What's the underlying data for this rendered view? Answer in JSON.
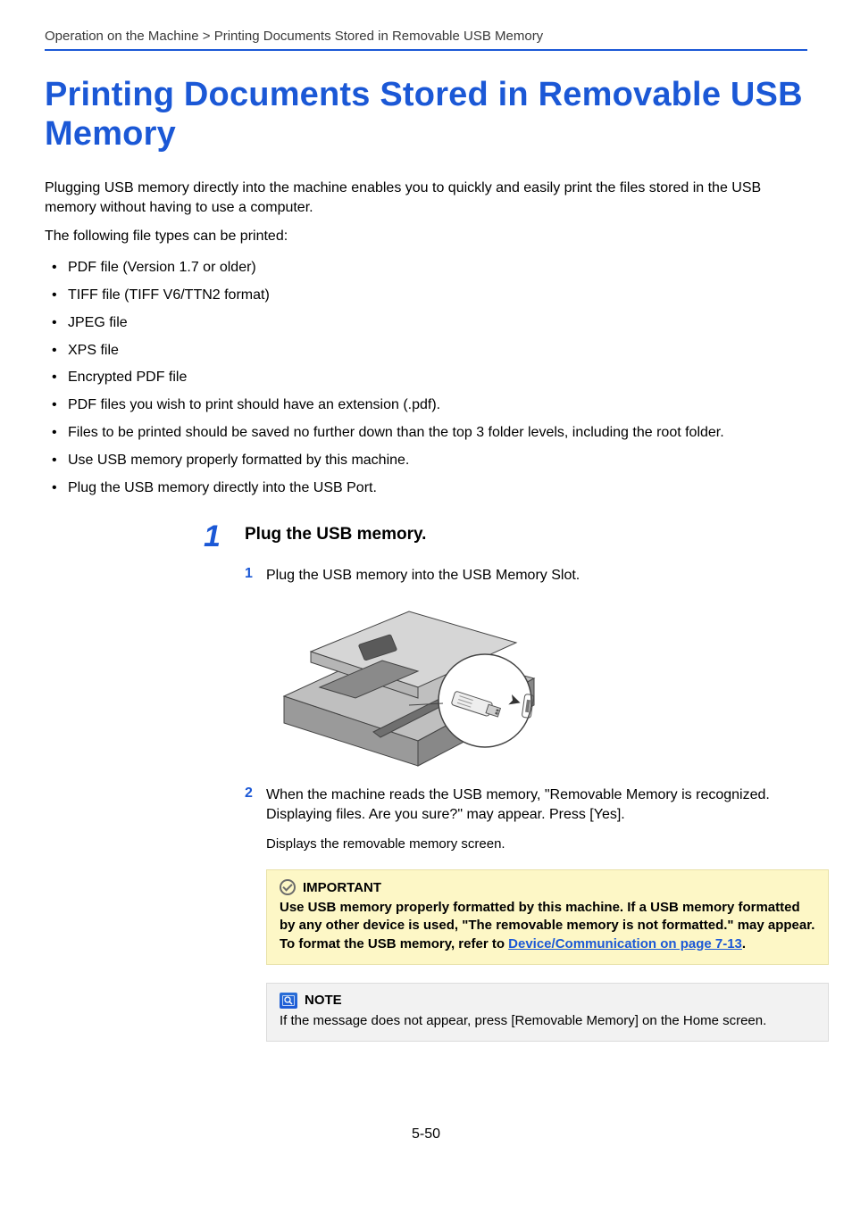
{
  "breadcrumb": "Operation on the Machine > Printing Documents Stored in Removable USB Memory",
  "title": "Printing Documents Stored in Removable USB Memory",
  "intro_p1": "Plugging USB memory directly into the machine enables you to quickly and easily print the files stored in the USB memory without having to use a computer.",
  "intro_p2": "The following file types can be printed:",
  "file_list": [
    "PDF file (Version 1.7 or older)",
    "TIFF file (TIFF V6/TTN2 format)",
    "JPEG file",
    "XPS file",
    "Encrypted PDF file",
    "PDF files you wish to print should have an extension (.pdf).",
    "Files to be printed should be saved no further down than the top 3 folder levels, including the root folder.",
    "Use USB memory properly formatted by this machine.",
    "Plug the USB memory directly into the USB Port."
  ],
  "step1": {
    "number": "1",
    "heading": "Plug the USB memory.",
    "sub1_num": "1",
    "sub1_text": "Plug the USB memory into the USB Memory Slot.",
    "sub2_num": "2",
    "sub2_text": "When the machine reads the USB memory, \"Removable Memory is recognized. Displaying files. Are you sure?\" may appear. Press [Yes].",
    "sub2_after": "Displays the removable memory screen."
  },
  "important": {
    "label": "IMPORTANT",
    "text_before_link": "Use USB memory properly formatted by this machine. If a USB memory formatted by any other device is used, \"The removable memory is not formatted.\" may appear. To format the USB memory, refer to ",
    "link_text": "Device/Communication on page 7-13",
    "text_after_link": "."
  },
  "note": {
    "label": "NOTE",
    "text": "If the message does not appear, press [Removable Memory] on the Home screen."
  },
  "page_number": "5-50"
}
